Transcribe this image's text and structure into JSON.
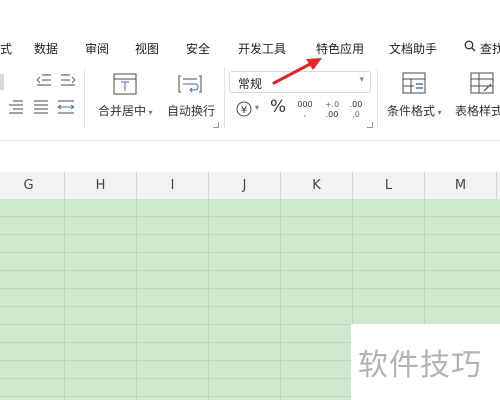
{
  "ribbon_tabs": [
    {
      "label": "式"
    },
    {
      "label": "数据"
    },
    {
      "label": "审阅"
    },
    {
      "label": "视图"
    },
    {
      "label": "安全"
    },
    {
      "label": "开发工具"
    },
    {
      "label": "特色应用"
    },
    {
      "label": "文档助手"
    },
    {
      "label": "查找"
    }
  ],
  "ribbon": {
    "merge_center": "合并居中",
    "auto_wrap": "自动换行",
    "number_format": "常规",
    "percent_symbol": "%",
    "thousands_symbol": "000",
    "decimal_increase": "+.0\n.00",
    "decimal_decrease": "-.0\n.00",
    "conditional_format": "条件格式",
    "table_style": "表格样式"
  },
  "columns": [
    "G",
    "H",
    "I",
    "J",
    "K",
    "L",
    "M"
  ],
  "watermark": "软件技巧",
  "colors": {
    "grid_fill": "#cde8cf",
    "grid_line": "#b7d9ba",
    "arrow": "#e0262a",
    "icon_blue": "#4a6da7"
  }
}
